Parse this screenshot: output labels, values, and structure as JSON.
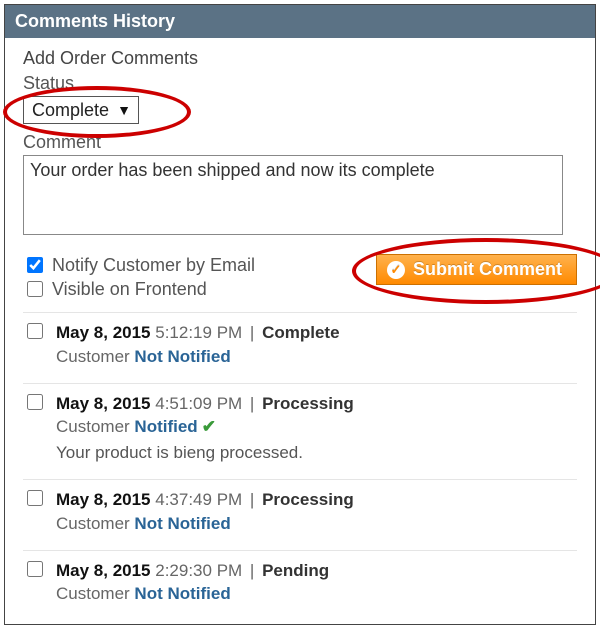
{
  "panel": {
    "title": "Comments History"
  },
  "form": {
    "heading": "Add Order Comments",
    "status_label": "Status",
    "status_selected": "Complete",
    "comment_label": "Comment",
    "comment_value": "Your order has been shipped and now its complete",
    "notify_label": "Notify Customer by Email",
    "notify_checked": true,
    "visible_label": "Visible on Frontend",
    "visible_checked": false,
    "submit_label": "Submit Comment"
  },
  "history": [
    {
      "date": "May 8, 2015",
      "time": "5:12:19 PM",
      "status": "Complete",
      "customer_label": "Customer",
      "notified_text": "Not Notified",
      "notified": false,
      "comment": ""
    },
    {
      "date": "May 8, 2015",
      "time": "4:51:09 PM",
      "status": "Processing",
      "customer_label": "Customer",
      "notified_text": "Notified",
      "notified": true,
      "comment": "Your product is bieng processed."
    },
    {
      "date": "May 8, 2015",
      "time": "4:37:49 PM",
      "status": "Processing",
      "customer_label": "Customer",
      "notified_text": "Not Notified",
      "notified": false,
      "comment": ""
    },
    {
      "date": "May 8, 2015",
      "time": "2:29:30 PM",
      "status": "Pending",
      "customer_label": "Customer",
      "notified_text": "Not Notified",
      "notified": false,
      "comment": ""
    }
  ]
}
